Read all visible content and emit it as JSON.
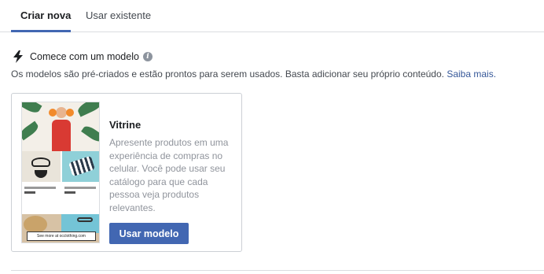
{
  "tabs": {
    "create_new": "Criar nova",
    "use_existing": "Usar existente"
  },
  "section": {
    "title": "Comece com um modelo",
    "info_icon": "i",
    "description": "Os modelos são pré-criados e estão prontos para serem usados. Basta adicionar seu próprio conteúdo.",
    "learn_more": "Saiba mais."
  },
  "template_card": {
    "title": "Vitrine",
    "description": "Apresente produtos em uma experiência de compras no celular. Você pode usar seu catálogo para que cada pessoa veja produtos relevantes.",
    "button_label": "Usar modelo",
    "preview_cta": "See more at occlothing.com"
  },
  "colors": {
    "accent": "#4267b2",
    "link": "#365899",
    "muted_text": "#90949c"
  }
}
